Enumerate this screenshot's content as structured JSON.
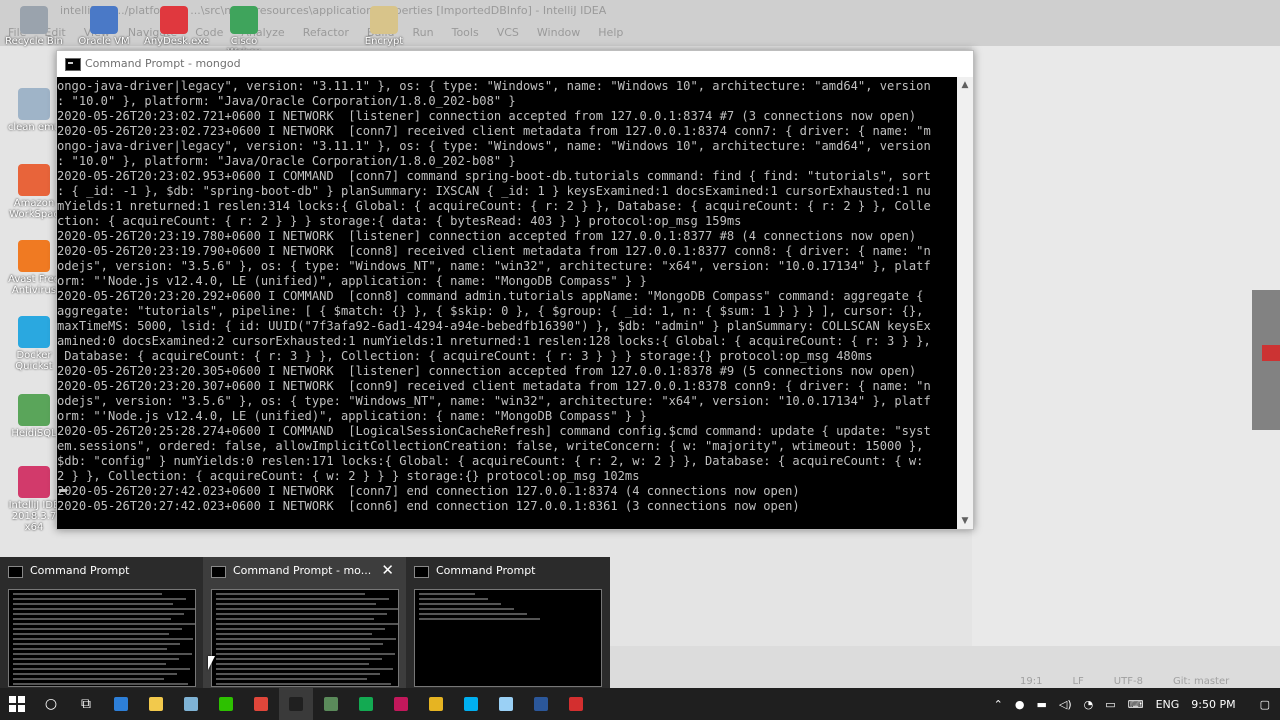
{
  "ide": {
    "title": "intelliDB [.../platform] - ...\\src\\main\\resources\\application.properties [ImportedDBInfo] - IntelliJ IDEA",
    "menu": [
      "File",
      "Edit",
      "View",
      "Navigate",
      "Code",
      "Analyze",
      "Refactor",
      "Build",
      "Run",
      "Tools",
      "VCS",
      "Window",
      "Help"
    ],
    "status": [
      "19:1",
      "LF",
      "UTF-8",
      "Git: master"
    ]
  },
  "desktop": {
    "top_icons": [
      {
        "label": "Recycle Bin",
        "color": "#9aa3ad"
      },
      {
        "label": "Oracle VM",
        "color": "#4a79c7"
      },
      {
        "label": "AnyDesk.exe",
        "color": "#e0383e"
      },
      {
        "label": "Cisco Webex",
        "color": "#3fa45c"
      },
      {
        "label": "Encrypt",
        "color": "#d8c48a"
      }
    ],
    "side_icons": [
      {
        "label": "clean emu",
        "color": "#9fb4c8"
      },
      {
        "label": "Amazon WorkSpac",
        "color": "#e8643a"
      },
      {
        "label": "Avast Free Antivirus",
        "color": "#f07a22"
      },
      {
        "label": "Docker Quickst",
        "color": "#2aa8e0"
      },
      {
        "label": "HeidiSQL",
        "color": "#5aa55a"
      },
      {
        "label": "IntelliJ IDE 2018.3.7 x64",
        "color": "#d23a6b"
      }
    ]
  },
  "cmd": {
    "title": "Command Prompt - mongod",
    "lines": [
      "ongo-java-driver|legacy\", version: \"3.11.1\" }, os: { type: \"Windows\", name: \"Windows 10\", architecture: \"amd64\", version",
      ": \"10.0\" }, platform: \"Java/Oracle Corporation/1.8.0_202-b08\" }",
      "2020-05-26T20:23:02.721+0600 I NETWORK  [listener] connection accepted from 127.0.0.1:8374 #7 (3 connections now open)",
      "2020-05-26T20:23:02.723+0600 I NETWORK  [conn7] received client metadata from 127.0.0.1:8374 conn7: { driver: { name: \"m",
      "ongo-java-driver|legacy\", version: \"3.11.1\" }, os: { type: \"Windows\", name: \"Windows 10\", architecture: \"amd64\", version",
      ": \"10.0\" }, platform: \"Java/Oracle Corporation/1.8.0_202-b08\" }",
      "2020-05-26T20:23:02.953+0600 I COMMAND  [conn7] command spring-boot-db.tutorials command: find { find: \"tutorials\", sort",
      ": { _id: -1 }, $db: \"spring-boot-db\" } planSummary: IXSCAN { _id: 1 } keysExamined:1 docsExamined:1 cursorExhausted:1 nu",
      "mYields:1 nreturned:1 reslen:314 locks:{ Global: { acquireCount: { r: 2 } }, Database: { acquireCount: { r: 2 } }, Colle",
      "ction: { acquireCount: { r: 2 } } } storage:{ data: { bytesRead: 403 } } protocol:op_msg 159ms",
      "2020-05-26T20:23:19.780+0600 I NETWORK  [listener] connection accepted from 127.0.0.1:8377 #8 (4 connections now open)",
      "2020-05-26T20:23:19.790+0600 I NETWORK  [conn8] received client metadata from 127.0.0.1:8377 conn8: { driver: { name: \"n",
      "odejs\", version: \"3.5.6\" }, os: { type: \"Windows_NT\", name: \"win32\", architecture: \"x64\", version: \"10.0.17134\" }, platf",
      "orm: \"'Node.js v12.4.0, LE (unified)\", application: { name: \"MongoDB Compass\" } }",
      "2020-05-26T20:23:20.292+0600 I COMMAND  [conn8] command admin.tutorials appName: \"MongoDB Compass\" command: aggregate {",
      "aggregate: \"tutorials\", pipeline: [ { $match: {} }, { $skip: 0 }, { $group: { _id: 1, n: { $sum: 1 } } } ], cursor: {},",
      "maxTimeMS: 5000, lsid: { id: UUID(\"7f3afa92-6ad1-4294-a94e-bebedfb16390\") }, $db: \"admin\" } planSummary: COLLSCAN keysEx",
      "amined:0 docsExamined:2 cursorExhausted:1 numYields:1 nreturned:1 reslen:128 locks:{ Global: { acquireCount: { r: 3 } },",
      " Database: { acquireCount: { r: 3 } }, Collection: { acquireCount: { r: 3 } } } storage:{} protocol:op_msg 480ms",
      "2020-05-26T20:23:20.305+0600 I NETWORK  [listener] connection accepted from 127.0.0.1:8378 #9 (5 connections now open)",
      "2020-05-26T20:23:20.307+0600 I NETWORK  [conn9] received client metadata from 127.0.0.1:8378 conn9: { driver: { name: \"n",
      "odejs\", version: \"3.5.6\" }, os: { type: \"Windows_NT\", name: \"win32\", architecture: \"x64\", version: \"10.0.17134\" }, platf",
      "orm: \"'Node.js v12.4.0, LE (unified)\", application: { name: \"MongoDB Compass\" } }",
      "2020-05-26T20:25:28.274+0600 I COMMAND  [LogicalSessionCacheRefresh] command config.$cmd command: update { update: \"syst",
      "em.sessions\", ordered: false, allowImplicitCollectionCreation: false, writeConcern: { w: \"majority\", wtimeout: 15000 },",
      "$db: \"config\" } numYields:0 reslen:171 locks:{ Global: { acquireCount: { r: 2, w: 2 } }, Database: { acquireCount: { w:",
      "2 } }, Collection: { acquireCount: { w: 2 } } } storage:{} protocol:op_msg 102ms",
      "2020-05-26T20:27:42.023+0600 I NETWORK  [conn7] end connection 127.0.0.1:8374 (4 connections now open)",
      "2020-05-26T20:27:42.023+0600 I NETWORK  [conn6] end connection 127.0.0.1:8361 (3 connections now open)"
    ]
  },
  "thumbnails": [
    {
      "title": "Command Prompt",
      "hover": false,
      "close": ""
    },
    {
      "title": "Command Prompt - mo...",
      "hover": true,
      "close": "✕"
    },
    {
      "title": "Command Prompt",
      "hover": false,
      "close": ""
    }
  ],
  "taskbar": {
    "start_icon": "windows-start-icon",
    "apps": [
      {
        "name": "search-icon",
        "glyph": "○",
        "color": "#ffffff"
      },
      {
        "name": "task-view-icon",
        "glyph": "⧉",
        "color": "#ffffff"
      },
      {
        "name": "store-icon",
        "glyph": "",
        "color": "#2d7fd8"
      },
      {
        "name": "file-explorer-icon",
        "glyph": "",
        "color": "#f2c94c"
      },
      {
        "name": "notepad-icon",
        "glyph": "",
        "color": "#7fb3d5"
      },
      {
        "name": "wechat-icon",
        "glyph": "",
        "color": "#2dc100"
      },
      {
        "name": "chrome-icon",
        "glyph": "",
        "color": "#e0463a"
      },
      {
        "name": "command-prompt-icon",
        "glyph": "",
        "color": "#202020"
      },
      {
        "name": "mongodb-compass-icon",
        "glyph": "",
        "color": "#5a8a5a"
      },
      {
        "name": "green-app-icon",
        "glyph": "",
        "color": "#13aa52"
      },
      {
        "name": "intellij-icon",
        "glyph": "",
        "color": "#c2185b"
      },
      {
        "name": "yellow-app-icon",
        "glyph": "",
        "color": "#e6b422"
      },
      {
        "name": "skype-icon",
        "glyph": "",
        "color": "#00aff0"
      },
      {
        "name": "document-icon",
        "glyph": "",
        "color": "#9ad0f5"
      },
      {
        "name": "word-icon",
        "glyph": "",
        "color": "#2b579a"
      },
      {
        "name": "red-app-icon",
        "glyph": "",
        "color": "#d32f2f"
      }
    ],
    "tray": {
      "chevron": "⌃",
      "language": "ENG",
      "time": "9:50 PM"
    }
  }
}
